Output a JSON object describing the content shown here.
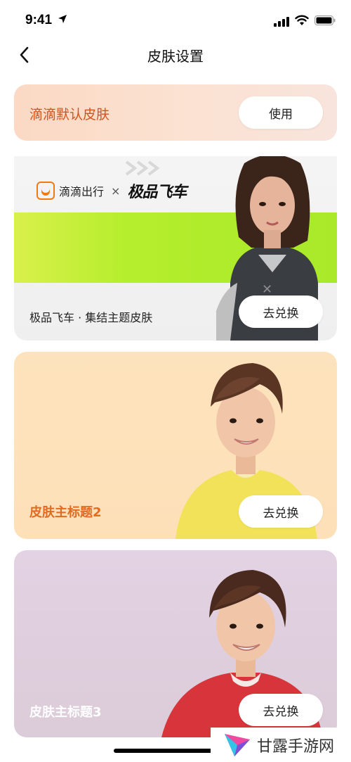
{
  "status_bar": {
    "time": "9:41"
  },
  "nav": {
    "title": "皮肤设置"
  },
  "cards": {
    "default": {
      "label": "滴滴默认皮肤",
      "button": "使用"
    },
    "speed": {
      "brand_text": "滴滴出行",
      "cross": "×",
      "partner_logo": "极品飞车",
      "label": "极品飞车 · 集结主题皮肤",
      "button": "去兑换"
    },
    "skin2": {
      "label": "皮肤主标题2",
      "button": "去兑换"
    },
    "skin3": {
      "label": "皮肤主标题3",
      "button": "去兑换"
    }
  },
  "watermark": {
    "text": "甘露手游网"
  },
  "colors": {
    "default_label": "#d2541d",
    "skin2_label": "#e06b21",
    "skin3_label": "#ffffff",
    "speed_green": "#b5ee2c"
  },
  "icons": [
    "back-icon",
    "location-arrow-icon",
    "signal-icon",
    "wifi-icon",
    "battery-icon",
    "didi-logo-icon"
  ]
}
